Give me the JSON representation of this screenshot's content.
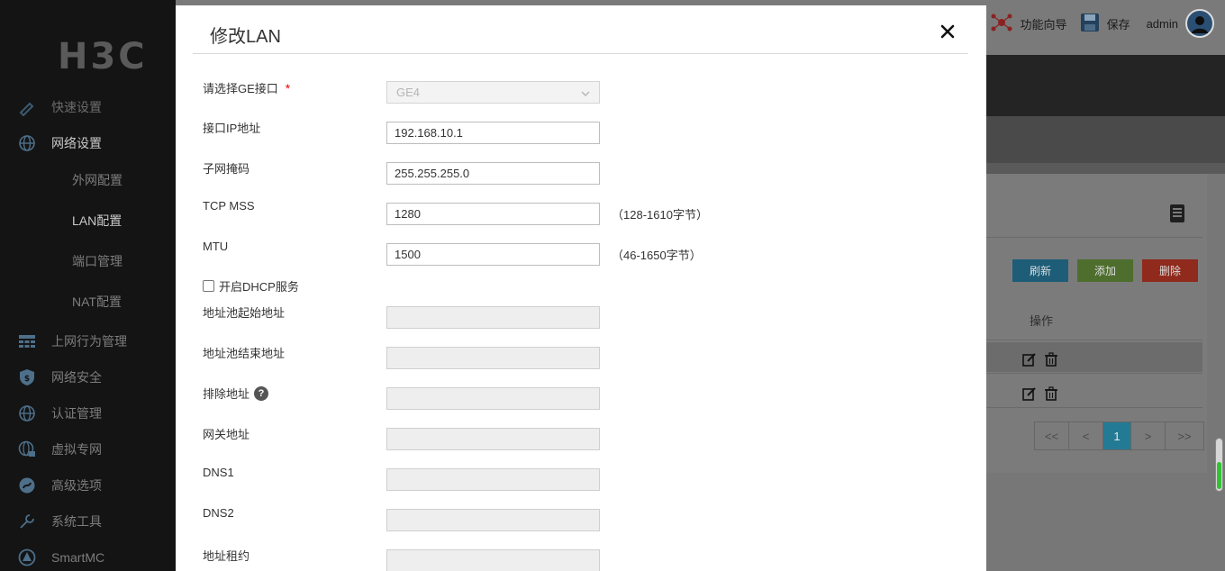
{
  "app": {
    "logo": "H3C",
    "sidebar": {
      "items": [
        {
          "label": "快速设置",
          "icon": "quick-setup-icon"
        },
        {
          "label": "网络设置",
          "icon": "globe-icon"
        },
        {
          "label": "外网配置"
        },
        {
          "label": "LAN配置"
        },
        {
          "label": "端口管理"
        },
        {
          "label": "NAT配置"
        },
        {
          "label": "上网行为管理",
          "icon": "grid-icon"
        },
        {
          "label": "网络安全",
          "icon": "shield-icon"
        },
        {
          "label": "认证管理",
          "icon": "globe-icon"
        },
        {
          "label": "虚拟专网",
          "icon": "vpn-globe-icon"
        },
        {
          "label": "高级选项",
          "icon": "advanced-icon"
        },
        {
          "label": "系统工具",
          "icon": "tools-icon"
        },
        {
          "label": "SmartMC",
          "icon": "smartmc-icon"
        }
      ]
    },
    "topbar": {
      "wizard_label": "功能向导",
      "save_label": "保存",
      "user": "admin"
    },
    "toolbar": {
      "refresh_label": "刷新",
      "add_label": "添加",
      "delete_label": "删除"
    },
    "table": {
      "op_header": "操作"
    },
    "pager": {
      "first": "<<",
      "prev": "<",
      "current": "1",
      "next": ">",
      "last": ">>"
    }
  },
  "modal": {
    "title": "修改LAN",
    "close_icon": "close-icon",
    "ge_label": "请选择GE接口",
    "ge_required": "*",
    "ge_value": "GE4",
    "ip_label": "接口IP地址",
    "ip_value": "192.168.10.1",
    "mask_label": "子网掩码",
    "mask_value": "255.255.255.0",
    "mss_label": "TCP MSS",
    "mss_value": "1280",
    "mss_hint": "（128-1610字节）",
    "mtu_label": "MTU",
    "mtu_value": "1500",
    "mtu_hint": "（46-1650字节）",
    "dhcp_label": "开启DHCP服务",
    "dhcp_checked": false,
    "pool_start_label": "地址池起始地址",
    "pool_end_label": "地址池结束地址",
    "exclude_label": "排除地址",
    "gateway_label": "网关地址",
    "dns1_label": "DNS1",
    "dns2_label": "DNS2",
    "lease_label": "地址租约"
  },
  "colors": {
    "refresh": "#1d5d78",
    "add": "#4e6e2e",
    "delete": "#8f2a1c",
    "page_current": "#237a94",
    "required": "#ee0000"
  }
}
